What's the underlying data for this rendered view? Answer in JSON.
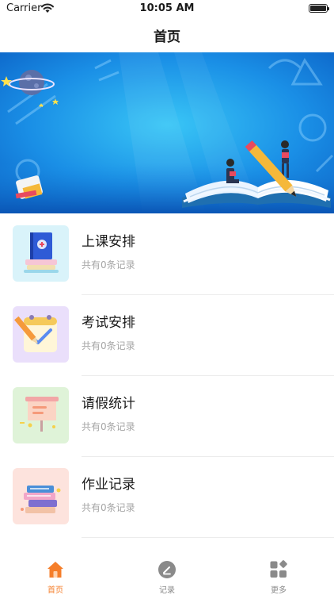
{
  "status_bar": {
    "carrier": "Carrier",
    "time": "10:05 AM",
    "battery_level": 1.0
  },
  "nav": {
    "title": "首页"
  },
  "banner": {
    "icon": "classroom-banner-image"
  },
  "list": {
    "items": [
      {
        "title": "上课安排",
        "subtitle": "共有0条记录",
        "icon": "books-icon",
        "bg": "#d9f3fa"
      },
      {
        "title": "考试安排",
        "subtitle": "共有0条记录",
        "icon": "calendar-check-icon",
        "bg": "#eadffb"
      },
      {
        "title": "请假统计",
        "subtitle": "共有0条记录",
        "icon": "presentation-board-icon",
        "bg": "#dff3d8"
      },
      {
        "title": "作业记录",
        "subtitle": "共有0条记录",
        "icon": "book-stack-icon",
        "bg": "#fde3dd"
      }
    ]
  },
  "tab_bar": {
    "tabs": [
      {
        "label": "首页",
        "icon": "home-icon",
        "active": true
      },
      {
        "label": "记录",
        "icon": "record-icon",
        "active": false
      },
      {
        "label": "更多",
        "icon": "more-grid-icon",
        "active": false
      }
    ],
    "accent": "#f57e2a",
    "inactive": "#8a8a8a"
  }
}
